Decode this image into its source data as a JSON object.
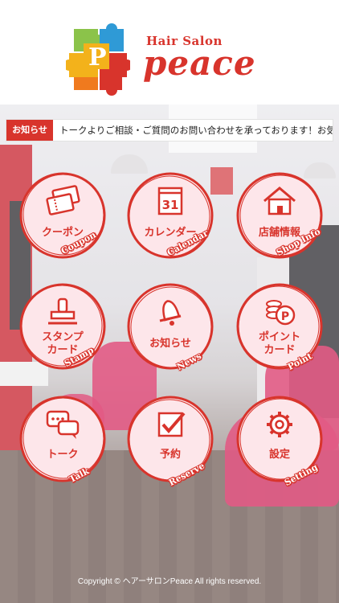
{
  "header": {
    "brand_small": "Hair Salon",
    "brand_big": "peace",
    "logo_letter": "P"
  },
  "notice": {
    "tag": "お知らせ",
    "text": "トークよりご相談・ご質問のお問い合わせを承っております！お気軽にご連絡ください。"
  },
  "menu": [
    {
      "label": "クーポン",
      "sub": "Coupon",
      "icon": "coupon-icon"
    },
    {
      "label": "カレンダー",
      "sub": "Calendar",
      "icon": "calendar-icon",
      "icon_text": "31"
    },
    {
      "label": "店舗情報",
      "sub": "Shop Info",
      "icon": "house-icon"
    },
    {
      "label": "スタンプ\nカード",
      "sub": "Stamp",
      "icon": "stamp-icon"
    },
    {
      "label": "お知らせ",
      "sub": "News",
      "icon": "bell-icon"
    },
    {
      "label": "ポイント\nカード",
      "sub": "Point",
      "icon": "point-coin-icon",
      "icon_text": "P"
    },
    {
      "label": "トーク",
      "sub": "Talk",
      "icon": "chat-bubble-icon"
    },
    {
      "label": "予約",
      "sub": "Reserve",
      "icon": "checkbox-icon"
    },
    {
      "label": "設定",
      "sub": "Setting",
      "icon": "gear-icon"
    }
  ],
  "footer": {
    "copyright": "Copyright © ヘアーサロンPeace All rights reserved."
  },
  "colors": {
    "accent": "#d8342c",
    "circle_fill": "#fde6ea"
  }
}
